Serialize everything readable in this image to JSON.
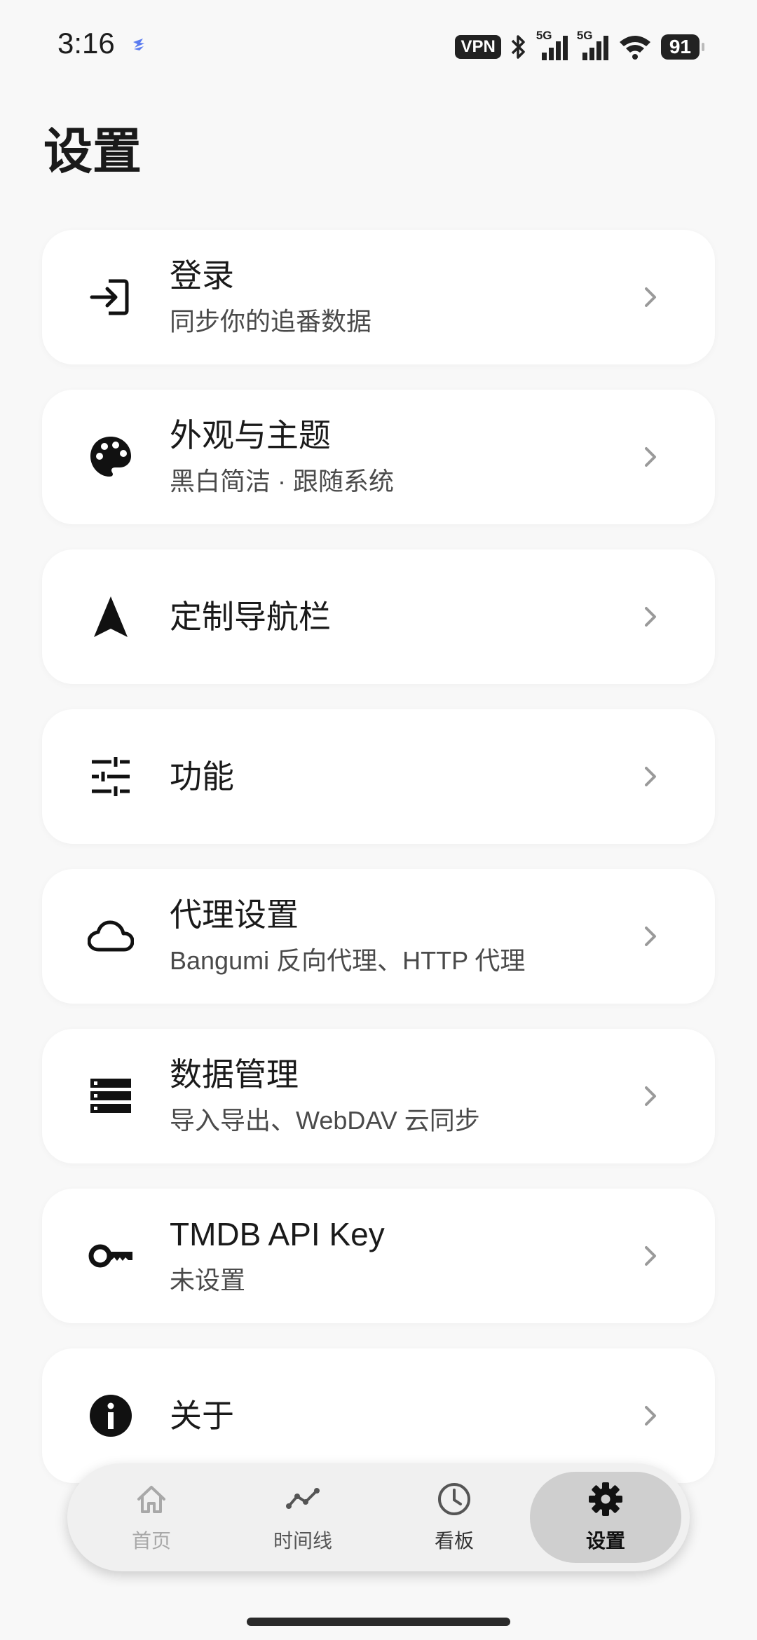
{
  "status_bar": {
    "time": "3:16",
    "vpn": "VPN",
    "signal1_label": "5G",
    "signal2_label": "5G",
    "battery": "91"
  },
  "page_title": "设置",
  "items": [
    {
      "title": "登录",
      "subtitle": "同步你的追番数据",
      "icon": "login-icon"
    },
    {
      "title": "外观与主题",
      "subtitle": "黑白简洁 · 跟随系统",
      "icon": "palette-icon"
    },
    {
      "title": "定制导航栏",
      "subtitle": "",
      "icon": "navigation-icon"
    },
    {
      "title": "功能",
      "subtitle": "",
      "icon": "tune-icon"
    },
    {
      "title": "代理设置",
      "subtitle": "Bangumi 反向代理、HTTP 代理",
      "icon": "cloud-icon"
    },
    {
      "title": "数据管理",
      "subtitle": "导入导出、WebDAV 云同步",
      "icon": "storage-icon"
    },
    {
      "title": "TMDB API Key",
      "subtitle": "未设置",
      "icon": "key-icon"
    },
    {
      "title": "关于",
      "subtitle": "",
      "icon": "info-icon"
    }
  ],
  "bottom_nav": [
    {
      "label": "首页",
      "icon": "home-icon",
      "active": false
    },
    {
      "label": "时间线",
      "icon": "timeline-icon",
      "active": false
    },
    {
      "label": "看板",
      "icon": "clock-icon",
      "active": false
    },
    {
      "label": "设置",
      "icon": "gear-icon",
      "active": true
    }
  ],
  "colors": {
    "background": "#f8f8f8",
    "card": "#ffffff",
    "nav_active": "#cfcfcf",
    "text": "#1a1a1a"
  }
}
